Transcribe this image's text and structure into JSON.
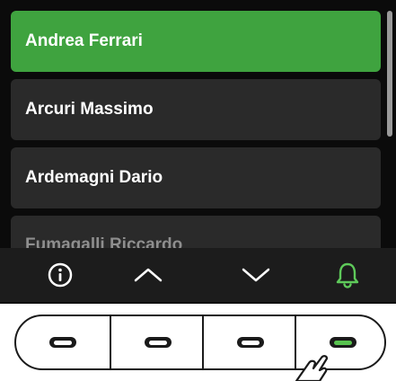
{
  "contacts": [
    {
      "name": "Andrea Ferrari",
      "selected": true
    },
    {
      "name": "Arcuri Massimo",
      "selected": false
    },
    {
      "name": "Ardemagni Dario",
      "selected": false
    },
    {
      "name": "Fumagalli Riccardo",
      "selected": false
    }
  ],
  "toolbar": {
    "buttons": [
      {
        "icon": "info-icon"
      },
      {
        "icon": "chevron-up-icon"
      },
      {
        "icon": "chevron-down-icon"
      },
      {
        "icon": "bell-icon"
      }
    ]
  },
  "hardware_keys": [
    {
      "active": false
    },
    {
      "active": false
    },
    {
      "active": false
    },
    {
      "active": true
    }
  ],
  "colors": {
    "selected": "#3fa33f",
    "item": "#2a2a2a",
    "bell": "#5ec95a",
    "active_led": "#57c24e"
  }
}
